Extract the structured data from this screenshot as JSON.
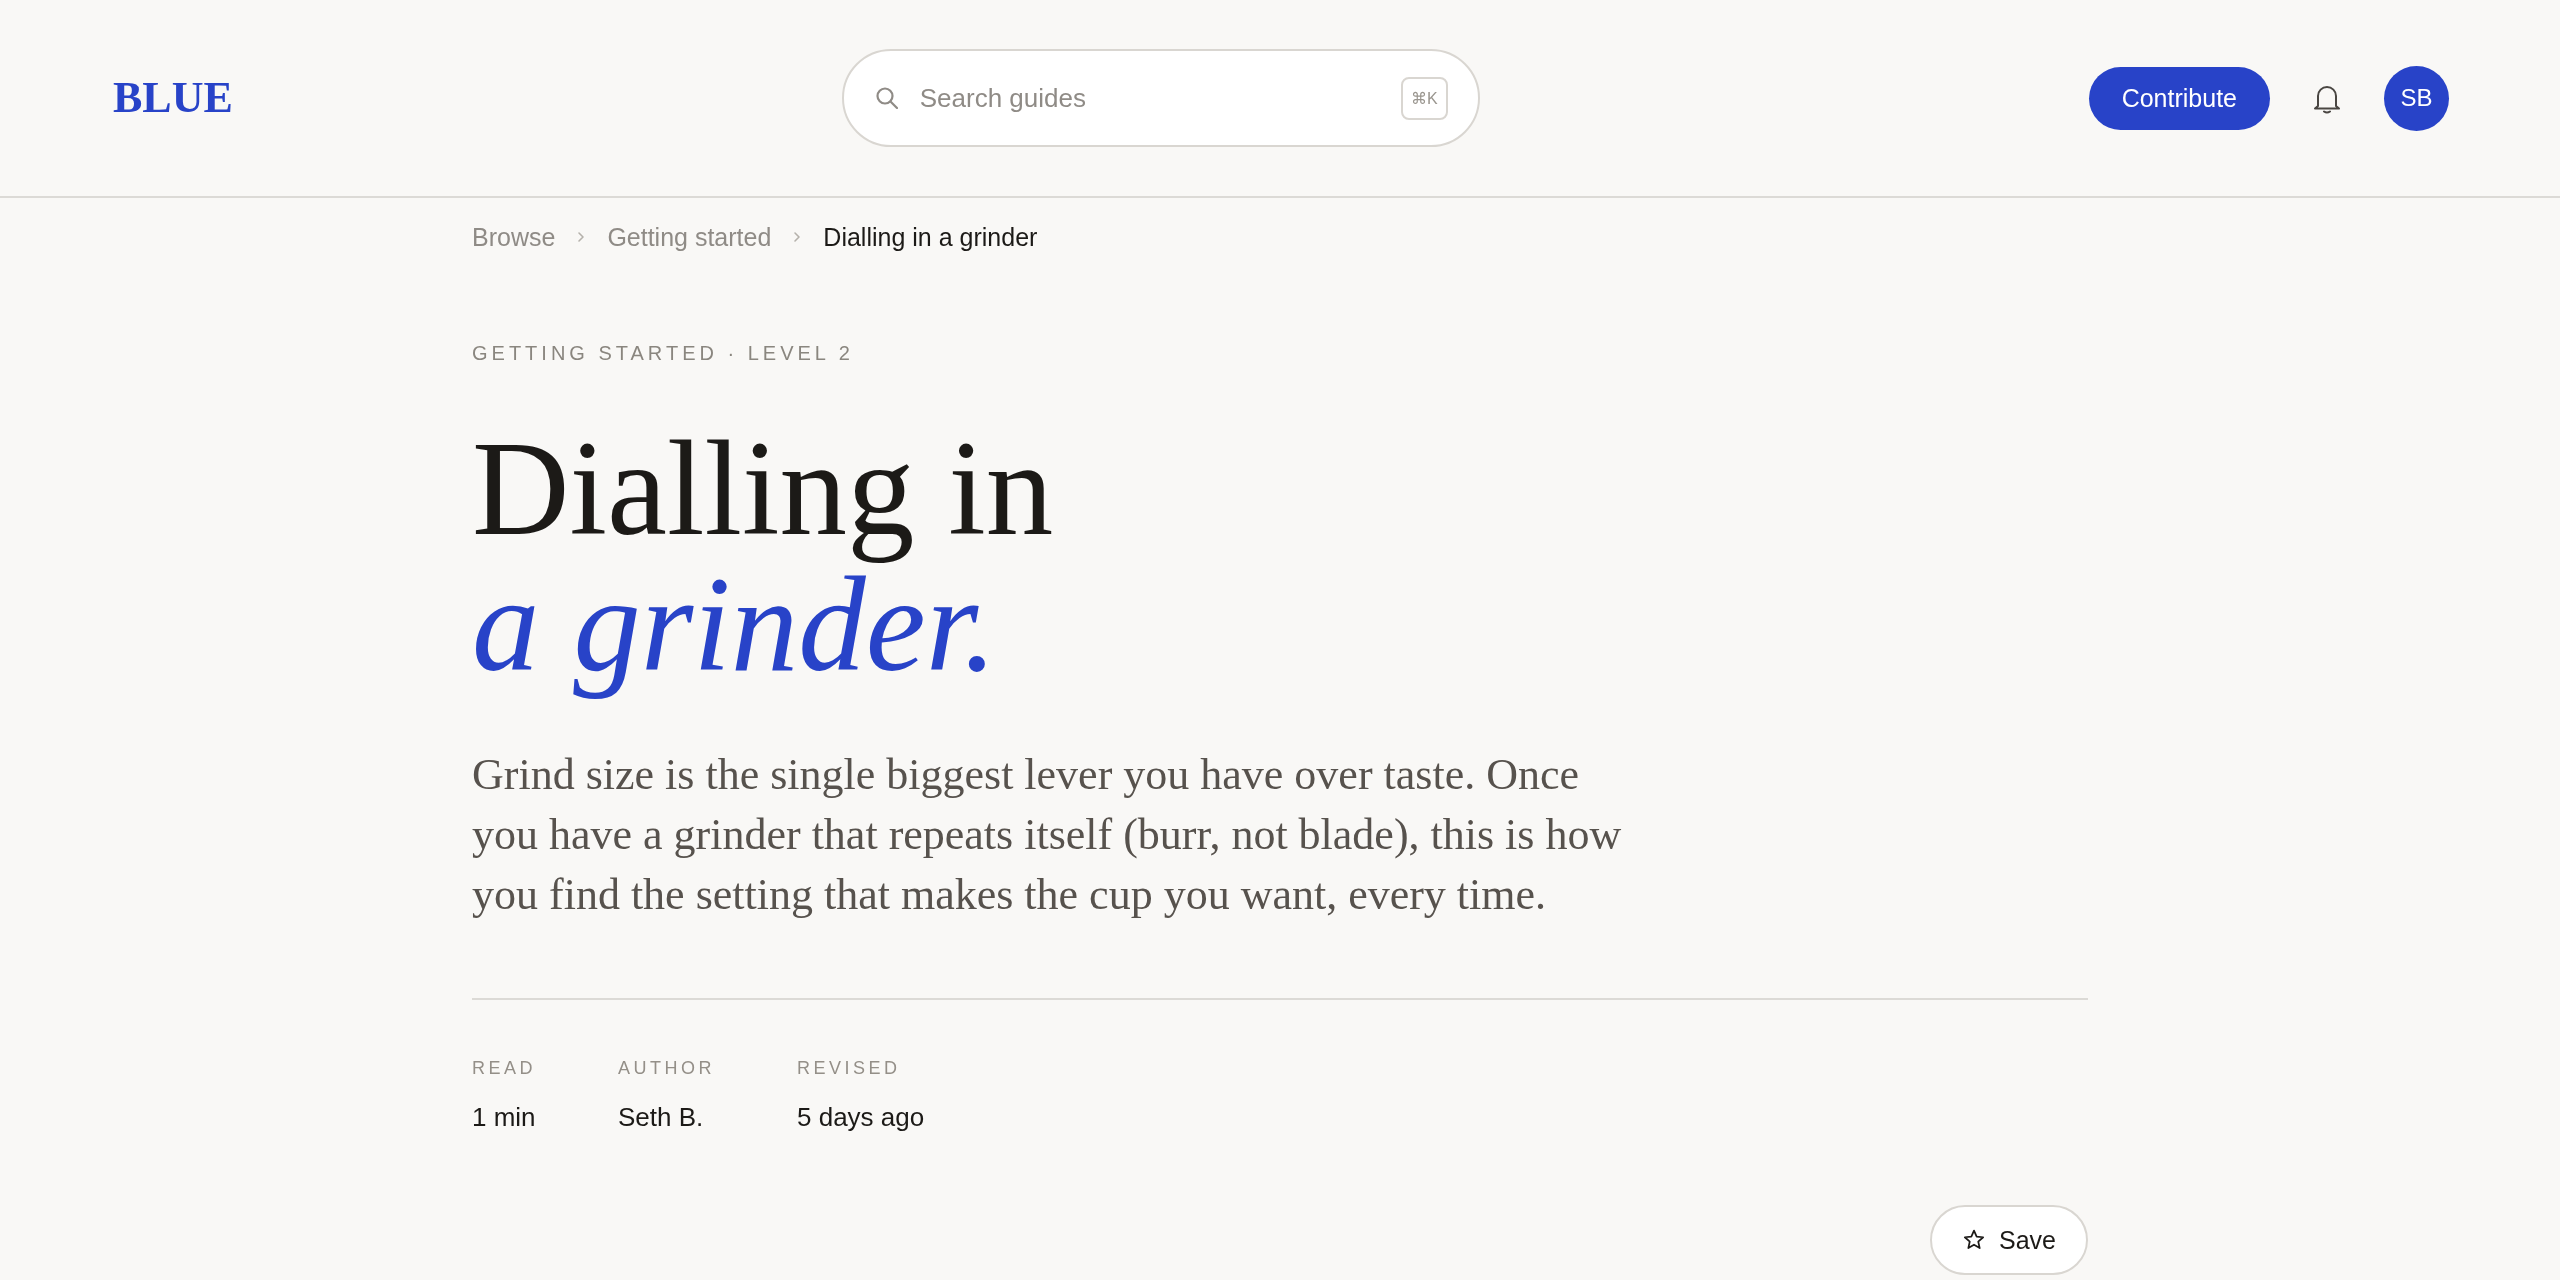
{
  "header": {
    "logo": "BLUE",
    "search": {
      "placeholder": "Search guides",
      "shortcut": "⌘K"
    },
    "contribute_button": "Contribute",
    "avatar": {
      "initials": "SB"
    }
  },
  "breadcrumb": [
    {
      "label": "Browse",
      "current": false
    },
    {
      "label": "Getting started",
      "current": false
    },
    {
      "label": "Dialling in a grinder",
      "current": true
    }
  ],
  "article": {
    "kicker": "GETTING STARTED · LEVEL 2",
    "title_lines": [
      {
        "kind": "plain",
        "text": "Dialling in"
      },
      {
        "kind": "accent",
        "text": "a grinder."
      }
    ],
    "lede": "Grind size is the single biggest lever you have over taste. Once you have a grinder that repeats itself (burr, not blade), this is how you find the setting that makes the cup you want, every time.",
    "meta": [
      {
        "label": "READ",
        "value": "1 min"
      },
      {
        "label": "AUTHOR",
        "value": "Seth B."
      },
      {
        "label": "REVISED",
        "value": "5 days ago"
      }
    ],
    "save_button": {
      "label": "Save"
    }
  }
}
